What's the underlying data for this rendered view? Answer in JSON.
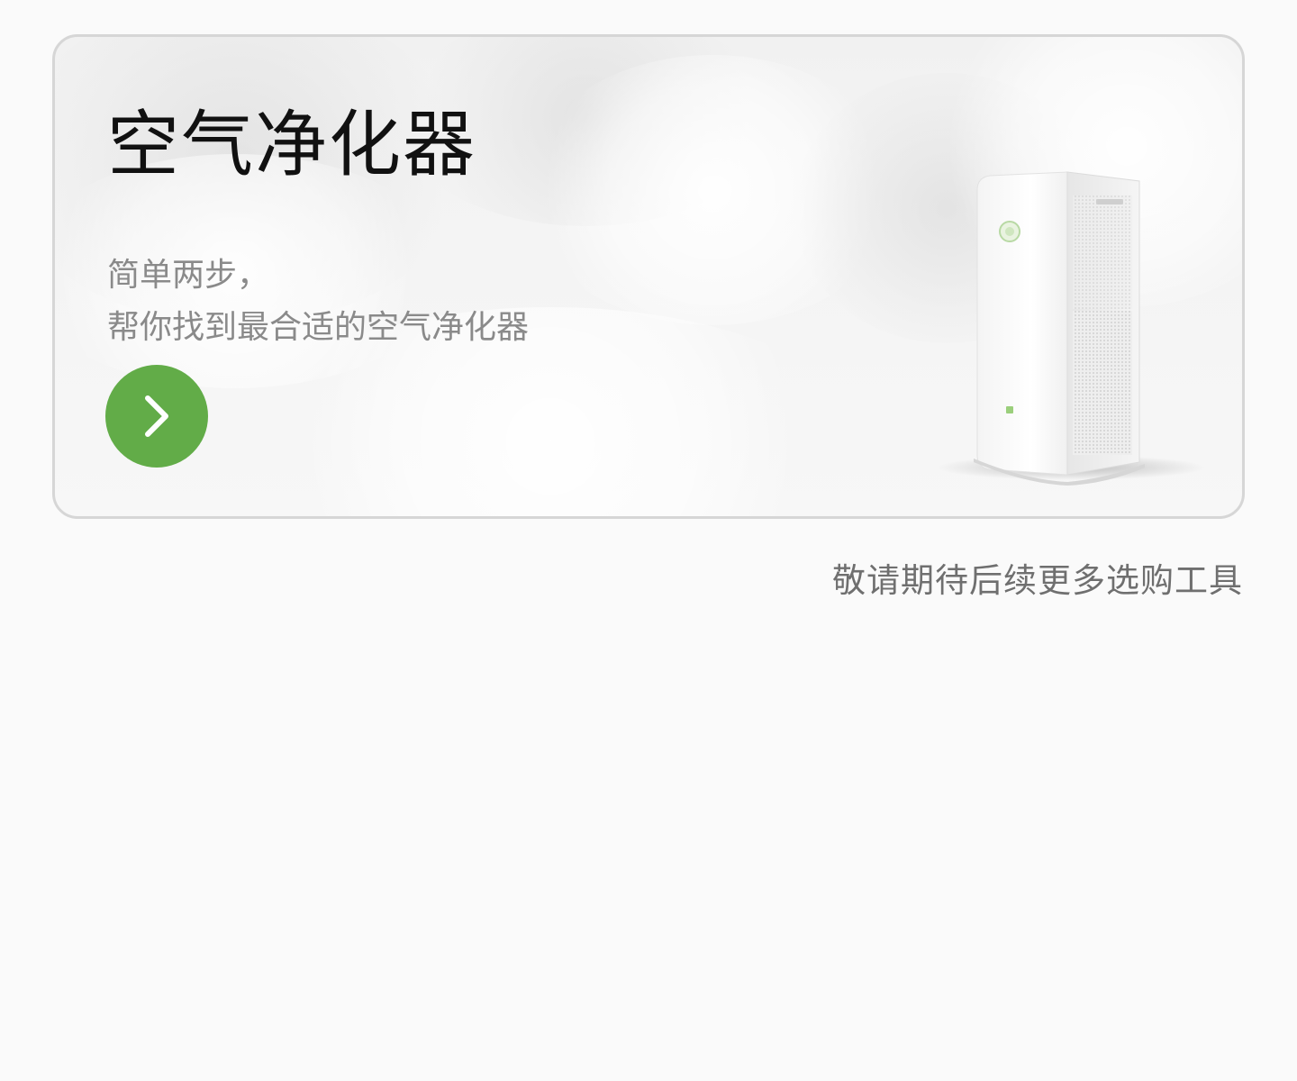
{
  "card": {
    "title": "空气净化器",
    "desc_line1": "简单两步，",
    "desc_line2": "帮你找到最合适的空气净化器",
    "go_icon": "chevron-right-icon",
    "accent_color": "#62ac48",
    "product_image": "air-purifier-image"
  },
  "footer": {
    "note": "敬请期待后续更多选购工具"
  }
}
